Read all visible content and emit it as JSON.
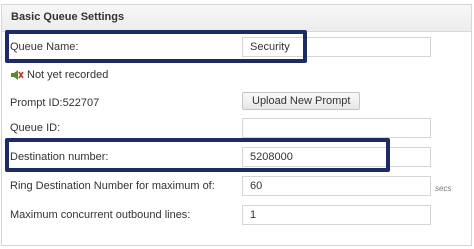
{
  "section": {
    "title": "Basic Queue Settings"
  },
  "queue_name": {
    "label": "Queue Name:",
    "value": "Security"
  },
  "recording": {
    "icon": "speaker-muted-icon",
    "status": "Not yet recorded"
  },
  "prompt": {
    "label": "Prompt ID:522707",
    "upload_label": "Upload New Prompt"
  },
  "queue_id": {
    "label": "Queue ID:",
    "value": ""
  },
  "destination": {
    "label": "Destination number:",
    "value": "5208000"
  },
  "ring_destination": {
    "label": "Ring Destination Number for maximum of:",
    "value": "60",
    "unit": "secs"
  },
  "max_outbound": {
    "label": "Maximum concurrent outbound lines:",
    "value": "1"
  },
  "colors": {
    "highlight_border": "#1c2a66",
    "header_bg": "#eeeeee",
    "field_border": "#d5d5d5"
  }
}
